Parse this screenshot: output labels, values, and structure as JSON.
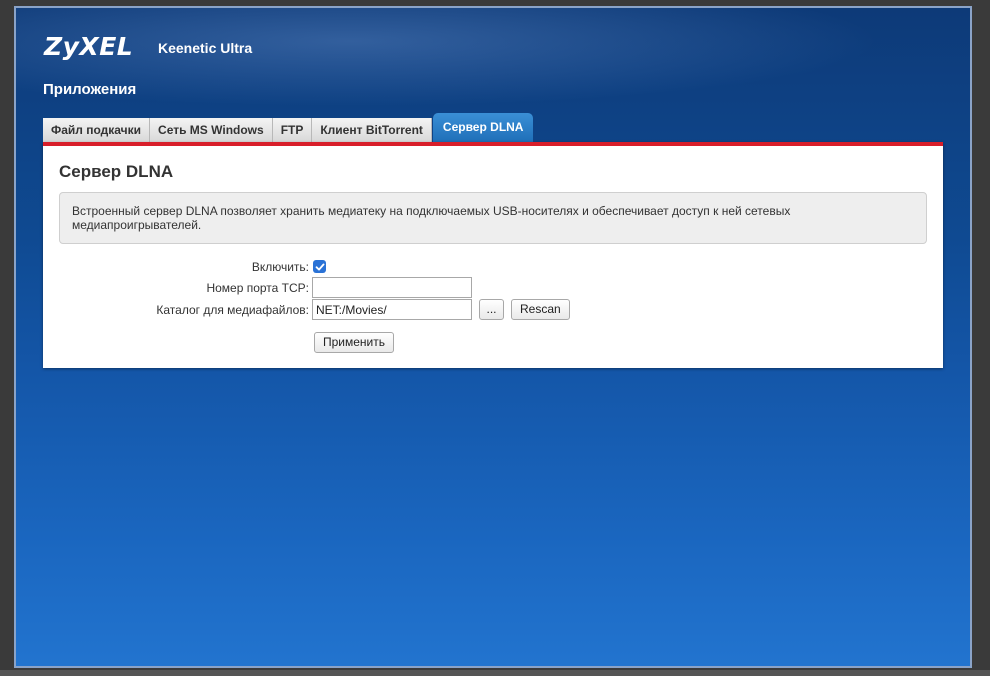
{
  "header": {
    "logo": "ZyXEL",
    "model": "Keenetic Ultra",
    "section": "Приложения"
  },
  "tabs": [
    {
      "label": "Файл подкачки",
      "active": false
    },
    {
      "label": "Сеть MS Windows",
      "active": false
    },
    {
      "label": "FTP",
      "active": false
    },
    {
      "label": "Клиент BitTorrent",
      "active": false
    },
    {
      "label": "Сервер DLNA",
      "active": true
    }
  ],
  "panel": {
    "title": "Сервер DLNA",
    "info": "Встроенный сервер DLNA позволяет хранить медиатеку на подключаемых USB-носителях и обеспечивает доступ к ней сетевых медиапроигрывателей."
  },
  "form": {
    "enable_label": "Включить:",
    "enable_checked": true,
    "port_label": "Номер порта TCP:",
    "port_value": "",
    "media_label": "Каталог для медиафайлов:",
    "media_value": "NET:/Movies/",
    "browse_label": "...",
    "rescan_label": "Rescan",
    "apply_label": "Применить"
  },
  "colors": {
    "accent_red": "#d81e2a",
    "active_tab": "#2a7cc6",
    "checkbox": "#2a72d6"
  }
}
